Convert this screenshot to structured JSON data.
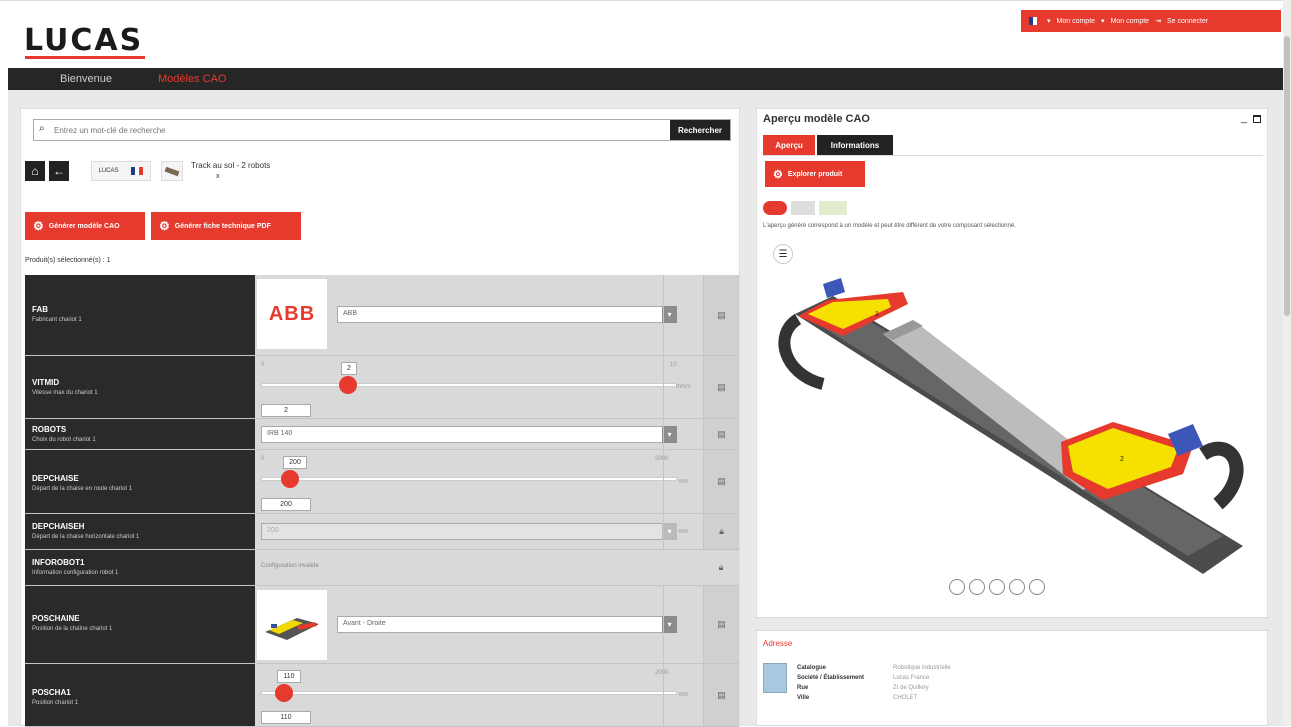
{
  "brand": {
    "logo": "LUCAS"
  },
  "user_bar": {
    "dropdown1": "Mon compte",
    "link2": "Mon compte",
    "logout": "Se connecter"
  },
  "nav": {
    "items": [
      "Bienvenue",
      "Modèles CAO"
    ]
  },
  "search": {
    "placeholder": "Entrez un mot-clé de recherche",
    "button": "Rechercher"
  },
  "breadcrumb": {
    "text": "Track au sol - 2 robots",
    "sub": "x"
  },
  "actions": {
    "cad_button": "Générer modèle CAO",
    "pdf_button": "Générer fiche technique PDF"
  },
  "products_count": "Produit(s) sélectionné(s) : 1",
  "params": [
    {
      "code": "FAB",
      "desc": "Fabricant chariot 1",
      "value": "ABB"
    },
    {
      "code": "VITMID",
      "desc": "Vitesse max du chariot 1",
      "min": "0",
      "max": "10",
      "current": "2",
      "slider_fraction": 0.3
    },
    {
      "code": "ROBOTS",
      "desc": "Choix du robot chariot 1",
      "value": "IRB 140"
    },
    {
      "code": "DEPCHAISE",
      "desc": "Départ de la chaise en route chariot 1",
      "min": "0",
      "max": "2000",
      "current": "200",
      "slider_fraction": 0.1
    },
    {
      "code": "DEPCHAISEH",
      "desc": "Départ de la chaise horizontale chariot 1",
      "value": "200"
    },
    {
      "code": "INFOROBOT1",
      "desc": "Information configuration robot 1",
      "value": "Configuration invalide"
    },
    {
      "code": "POSCHAINE",
      "desc": "Position de la chaîne chariot 1",
      "value": "Avant - Droite"
    },
    {
      "code": "POSCHA1",
      "desc": "Position chariot 1",
      "min": "0",
      "max": "2000",
      "current": "110",
      "slider_fraction": 0.09
    }
  ],
  "preview": {
    "title": "Aperçu modèle CAO",
    "tabs": [
      "Aperçu",
      "Informations"
    ],
    "reload_button": "Explorer produit",
    "description": "L'aperçu généré correspond à un modèle et peut être différent de votre composant sélectionné.",
    "labels": [
      "1",
      "2"
    ]
  },
  "address": {
    "title": "Adresse",
    "rows": [
      {
        "key": "Catalogue",
        "value": "Robotique industrielle"
      },
      {
        "key": "Société / Établissement",
        "value": "Lucas France"
      },
      {
        "key": "Rue",
        "value": "ZI de Quillery"
      },
      {
        "key": "Ville",
        "value": "CHOLET"
      }
    ]
  },
  "colors": {
    "accent": "#e63a2e",
    "dark": "#262626",
    "panel_bg": "#e9e9e9"
  }
}
